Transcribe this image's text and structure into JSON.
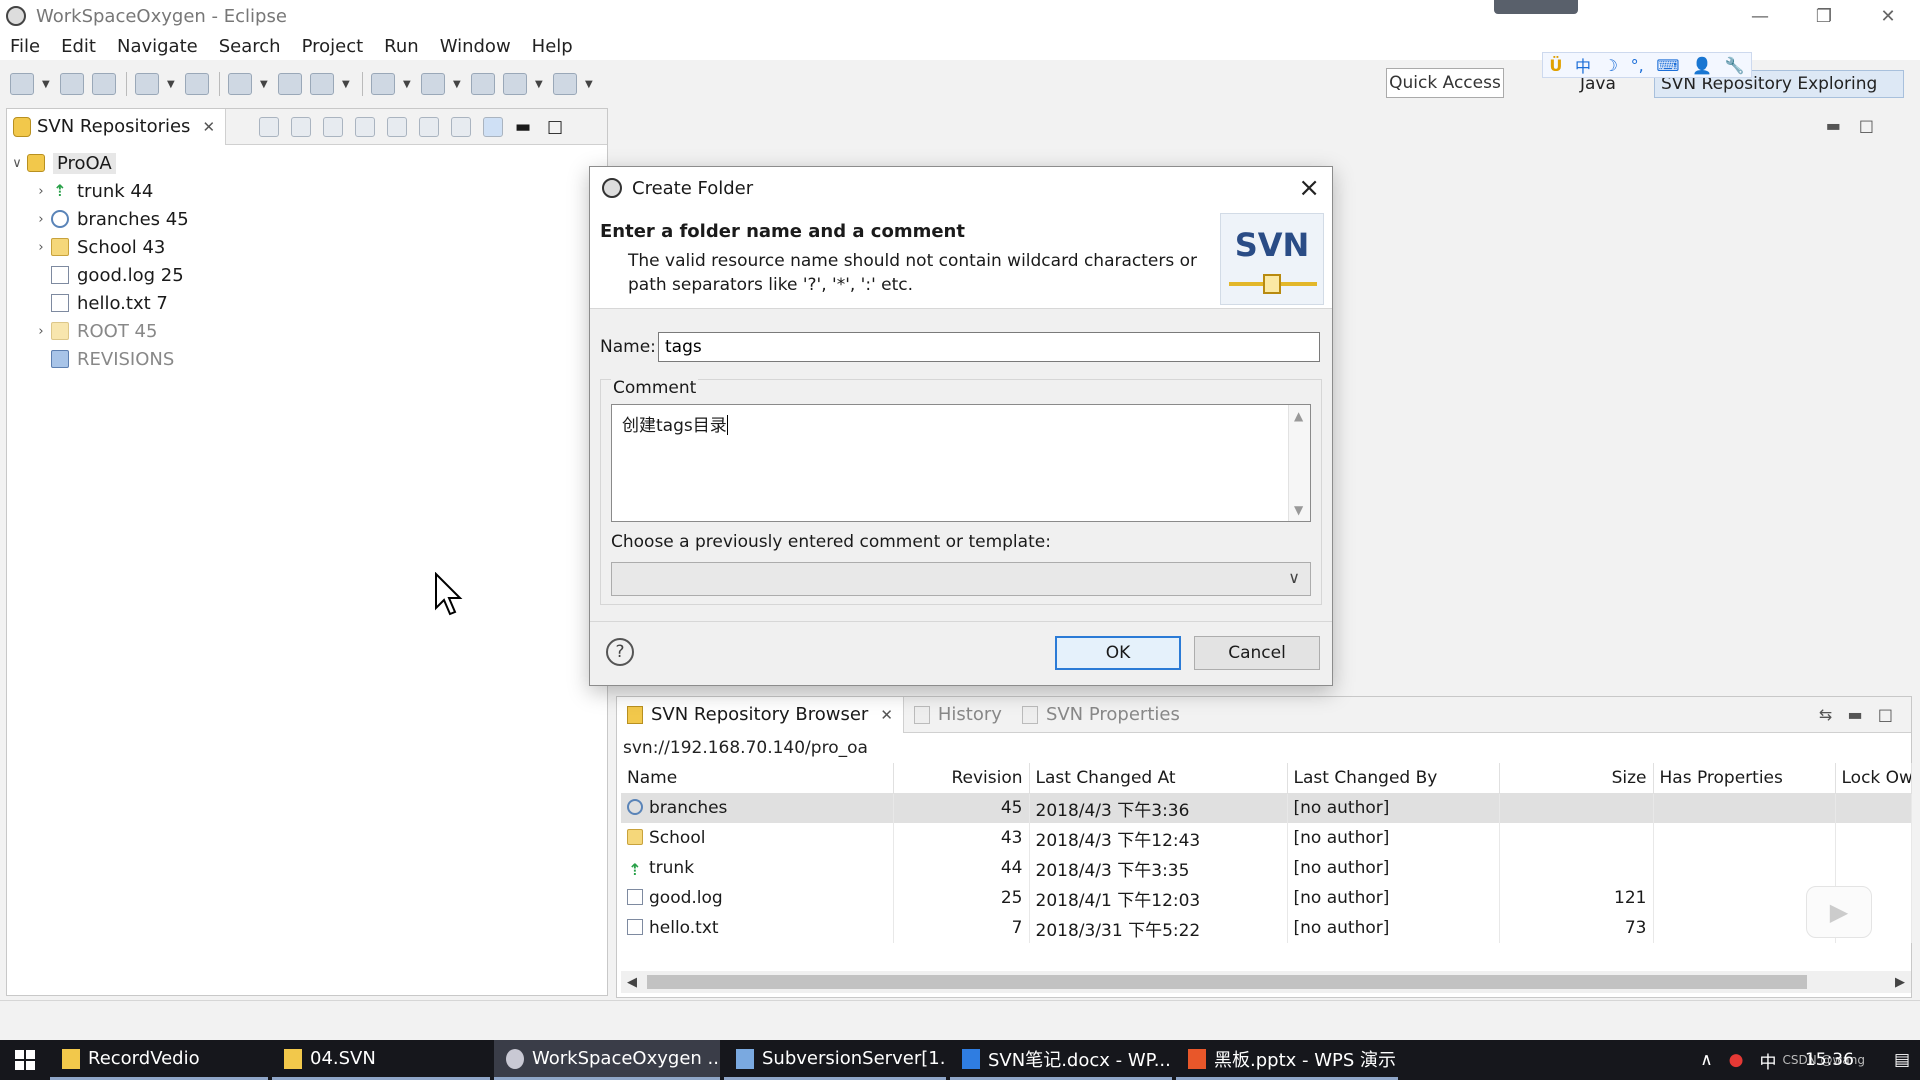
{
  "window": {
    "title": "WorkSpaceOxygen - Eclipse",
    "minimize": "—",
    "restore": "❐",
    "close": "✕"
  },
  "menu": [
    "File",
    "Edit",
    "Navigate",
    "Search",
    "Project",
    "Run",
    "Window",
    "Help"
  ],
  "toolbar": {
    "quick_access": "Quick Access",
    "perspectives": [
      {
        "label": "Java"
      },
      {
        "label": "SVN Repository Exploring"
      }
    ],
    "ime": [
      "中",
      "☽",
      "°,",
      "⌨",
      "👤",
      "🔧"
    ]
  },
  "svn_repositories": {
    "tab_label": "SVN Repositories",
    "tree": [
      {
        "label": "ProOA",
        "icon": "repo-icon",
        "expanded": true
      },
      {
        "label": "trunk 44",
        "icon": "trunk-icon"
      },
      {
        "label": "branches 45",
        "icon": "branches-icon"
      },
      {
        "label": "School 43",
        "icon": "folder-icon"
      },
      {
        "label": "good.log 25",
        "icon": "file-icon"
      },
      {
        "label": "hello.txt 7",
        "icon": "file-icon"
      },
      {
        "label": "ROOT 45",
        "icon": "folder-icon"
      },
      {
        "label": "REVISIONS",
        "icon": "revisions-icon"
      }
    ]
  },
  "dialog": {
    "title": "Create Folder",
    "header_title": "Enter a folder name and a comment",
    "header_desc": "The valid resource name should not contain wildcard characters or path separators like '?', '*', ':' etc.",
    "logo_text": "SVN",
    "name_label": "Name:",
    "name_value": "tags",
    "comment_label": "Comment",
    "comment_value": "创建tags目录",
    "template_label": "Choose a previously entered comment or template:",
    "template_value": "",
    "ok_label": "OK",
    "cancel_label": "Cancel",
    "help_label": "?"
  },
  "repo_browser": {
    "tabs": [
      {
        "label": "SVN Repository Browser",
        "active": true
      },
      {
        "label": "History",
        "active": false
      },
      {
        "label": "SVN Properties",
        "active": false
      }
    ],
    "url": "svn://192.168.70.140/pro_oa",
    "columns": [
      "Name",
      "Revision",
      "Last Changed At",
      "Last Changed By",
      "Size",
      "Has Properties",
      "Lock Own"
    ],
    "rows": [
      {
        "name": "branches",
        "revision": "45",
        "changed_at": "2018/4/3 下午3:36",
        "changed_by": "[no author]",
        "size": "",
        "icon": "branches-icon"
      },
      {
        "name": "School",
        "revision": "43",
        "changed_at": "2018/4/3 下午12:43",
        "changed_by": "[no author]",
        "size": "",
        "icon": "folder-icon"
      },
      {
        "name": "trunk",
        "revision": "44",
        "changed_at": "2018/4/3 下午3:35",
        "changed_by": "[no author]",
        "size": "",
        "icon": "trunk-icon"
      },
      {
        "name": "good.log",
        "revision": "25",
        "changed_at": "2018/4/1 下午12:03",
        "changed_by": "[no author]",
        "size": "121",
        "icon": "file-icon"
      },
      {
        "name": "hello.txt",
        "revision": "7",
        "changed_at": "2018/3/31 下午5:22",
        "changed_by": "[no author]",
        "size": "73",
        "icon": "file-icon"
      }
    ]
  },
  "taskbar": {
    "items": [
      {
        "label": "RecordVedio",
        "color": "#f2c84b"
      },
      {
        "label": "04.SVN",
        "color": "#f2c84b"
      },
      {
        "label": "WorkSpaceOxygen ...",
        "color": "#c9c9d4"
      },
      {
        "label": "SubversionServer[1...",
        "color": "#7aa9e0"
      },
      {
        "label": "SVN笔记.docx - WP...",
        "color": "#2f7de1"
      },
      {
        "label": "黑板.pptx - WPS 演示",
        "color": "#e8572a"
      }
    ],
    "tray_ime": "中",
    "clock": "15:36",
    "watermark": "CSDN @wang"
  }
}
